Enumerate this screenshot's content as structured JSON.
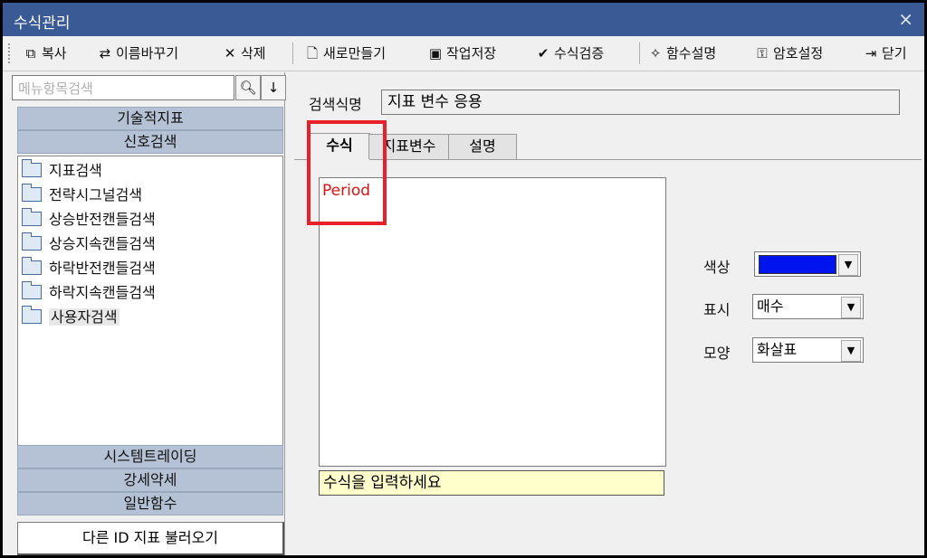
{
  "window": {
    "title": "수식관리",
    "close_icon": "×"
  },
  "toolbar": {
    "items": [
      {
        "label": "복사",
        "icon": "copy-icon"
      },
      {
        "label": "이름바꾸기",
        "icon": "rename-icon"
      },
      {
        "label": "삭제",
        "icon": "delete-icon"
      },
      {
        "label": "새로만들기",
        "icon": "new-file-icon"
      },
      {
        "label": "작업저장",
        "icon": "save-icon"
      },
      {
        "label": "수식검증",
        "icon": "check-icon"
      },
      {
        "label": "함수설명",
        "icon": "magic-wand-icon"
      },
      {
        "label": "암호설정",
        "icon": "key-icon"
      },
      {
        "label": "닫기",
        "icon": "exit-icon"
      }
    ]
  },
  "sidebar": {
    "search_placeholder": "메뉴항목검색",
    "categories_top": [
      "기술적지표",
      "신호검색"
    ],
    "tree": [
      "지표검색",
      "전략시그널검색",
      "상승반전캔들검색",
      "상승지속캔들검색",
      "하락반전캔들검색",
      "하락지속캔들검색",
      "사용자검색"
    ],
    "categories_bottom": [
      "시스템트레이딩",
      "강세약세",
      "일반함수"
    ],
    "load_button": "다른 ID 지표 불러오기"
  },
  "main": {
    "name_label": "검색식명",
    "name_value": "지표 변수 응용",
    "tabs": [
      "수식",
      "지표변수",
      "설명"
    ],
    "active_tab": "수식",
    "formula": "Period",
    "hint": "수식을 입력하세요",
    "props": {
      "color_label": "색상",
      "color_value": "#0014f0",
      "display_label": "표시",
      "display_value": "매수",
      "shape_label": "모양",
      "shape_value": "화살표"
    }
  }
}
